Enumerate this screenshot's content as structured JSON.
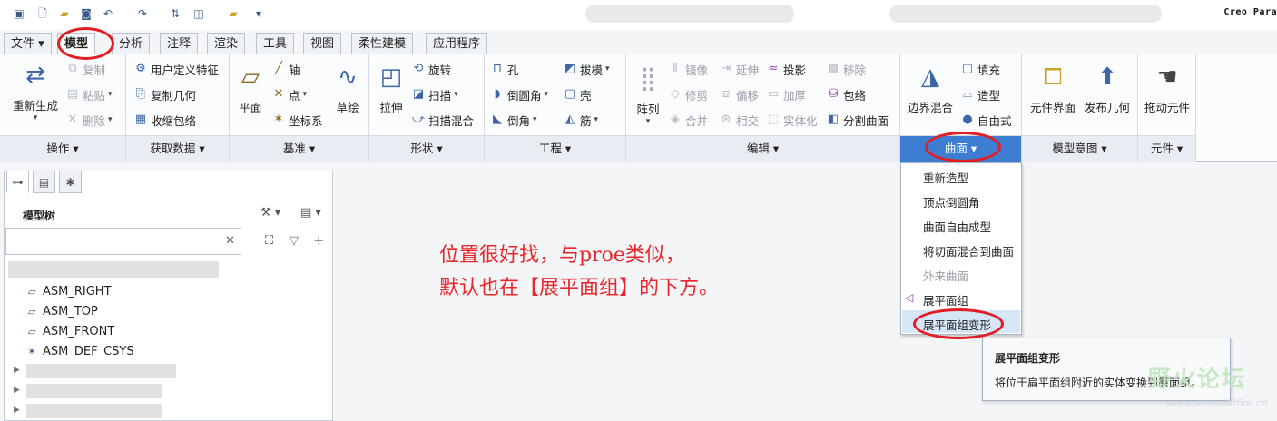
{
  "window": {
    "title": "Creo Para"
  },
  "tabs": [
    "文件",
    "模型",
    "分析",
    "注释",
    "渲染",
    "工具",
    "视图",
    "柔性建模",
    "应用程序"
  ],
  "ribbon": {
    "operations": {
      "regenerate": "重新生成",
      "copy": "复制",
      "paste": "粘贴",
      "delete": "删除",
      "footer": "操作"
    },
    "get_data": {
      "user_feature": "用户定义特征",
      "copy_geom": "复制几何",
      "shrinkwrap": "收缩包络",
      "footer": "获取数据"
    },
    "datum": {
      "plane": "平面",
      "axis": "轴",
      "point": "点",
      "csys": "坐标系",
      "sketch": "草绘",
      "footer": "基准"
    },
    "shapes": {
      "extrude": "拉伸",
      "revolve": "旋转",
      "sweep": "扫描",
      "swept_blend": "扫描混合",
      "footer": "形状"
    },
    "engineering": {
      "hole": "孔",
      "round": "倒圆角",
      "chamfer": "倒角",
      "draft": "拔模",
      "shell": "壳",
      "rib": "筋",
      "footer": "工程"
    },
    "editing": {
      "pattern": "阵列",
      "mirror": "镜像",
      "trim": "修剪",
      "merge": "合并",
      "extend": "延伸",
      "offset": "偏移",
      "intersect": "相交",
      "project": "投影",
      "thicken": "加厚",
      "solidify": "实体化",
      "remove": "移除",
      "wrap": "包络",
      "split_surface": "分割曲面",
      "footer": "编辑"
    },
    "surfaces": {
      "boundary_blend": "边界混合",
      "fill": "填充",
      "style": "造型",
      "freestyle": "自由式",
      "footer": "曲面"
    },
    "model_intent": {
      "component_interface": "元件界面",
      "publish_geom": "发布几何",
      "footer": "模型意图"
    },
    "components": {
      "drag_components": "拖动元件",
      "footer": "元件"
    }
  },
  "dropdown": {
    "items": [
      "重新造型",
      "顶点倒圆角",
      "曲面自由成型",
      "将切面混合到曲面",
      "外来曲面",
      "展平面组",
      "展平面组变形"
    ]
  },
  "tooltip": {
    "title": "展平面组变形",
    "desc": "将位于扁平面组附近的实体变换到原面组。"
  },
  "model_tree": {
    "label": "模型树",
    "items": [
      "ASM_RIGHT",
      "ASM_TOP",
      "ASM_FRONT",
      "ASM_DEF_CSYS"
    ]
  },
  "annotation": {
    "line1": "位置很好找，与proe类似，",
    "line2": "默认也在【展平面组】的下方。"
  },
  "watermark": {
    "text": "野火论坛",
    "url": "www.proewildfire.cn"
  },
  "colors": {
    "accent": "#3d7ed3",
    "annotation": "#e8262b",
    "circle": "#e31d24",
    "hover": "#d6e6f7"
  }
}
